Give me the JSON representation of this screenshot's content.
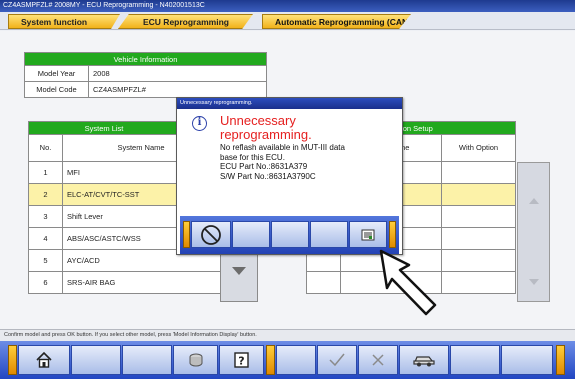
{
  "window": {
    "title": "CZ4ASMPFZL# 2008MY  -  ECU Reprogramming  -  N402001513C"
  },
  "tabs": [
    {
      "label": "System function"
    },
    {
      "label": "ECU Reprogramming"
    },
    {
      "label": "Automatic Reprogramming (CAN)"
    }
  ],
  "vehicle_info": {
    "header": "Vehicle Information",
    "rows": [
      {
        "label": "Model Year",
        "value": "2008"
      },
      {
        "label": "Model Code",
        "value": "CZ4ASMPFZL#"
      }
    ]
  },
  "system_list": {
    "header": "System List",
    "option_header": "Option Setup",
    "columns": {
      "no": "No.",
      "name": "System Name",
      "name_right": "me",
      "with_option": "With Option"
    },
    "rows": [
      {
        "no": "1",
        "name": "MFI"
      },
      {
        "no": "2",
        "name": "ELC-AT/CVT/TC-SST",
        "selected": true
      },
      {
        "no": "3",
        "name": "Shift Lever"
      },
      {
        "no": "4",
        "name": "ABS/ASC/ASTC/WSS"
      },
      {
        "no": "5",
        "name": "AYC/ACD"
      },
      {
        "no": "6",
        "name": "SRS-AIR BAG"
      }
    ]
  },
  "status_text": "Confirm model and press OK button. If you select other model, press 'Model Information Display' button.",
  "dialog": {
    "title": "Unnecessary reprogramming.",
    "heading_line1": "Unnecessary",
    "heading_line2": "reprogramming.",
    "body_line1": "No reflash available in MUT-III data",
    "body_line2": "base for this ECU.",
    "body_line3": "ECU Part No.:8631A379",
    "body_line4": "S/W Part No.:8631A3790C",
    "icons": [
      "info-icon",
      "cancel-icon",
      "print-icon"
    ]
  },
  "bottom_toolbar": {
    "icons": [
      "home-icon",
      "database-icon",
      "help-icon",
      "ok-check-icon",
      "cancel-x-icon",
      "vehicle-icon"
    ]
  }
}
